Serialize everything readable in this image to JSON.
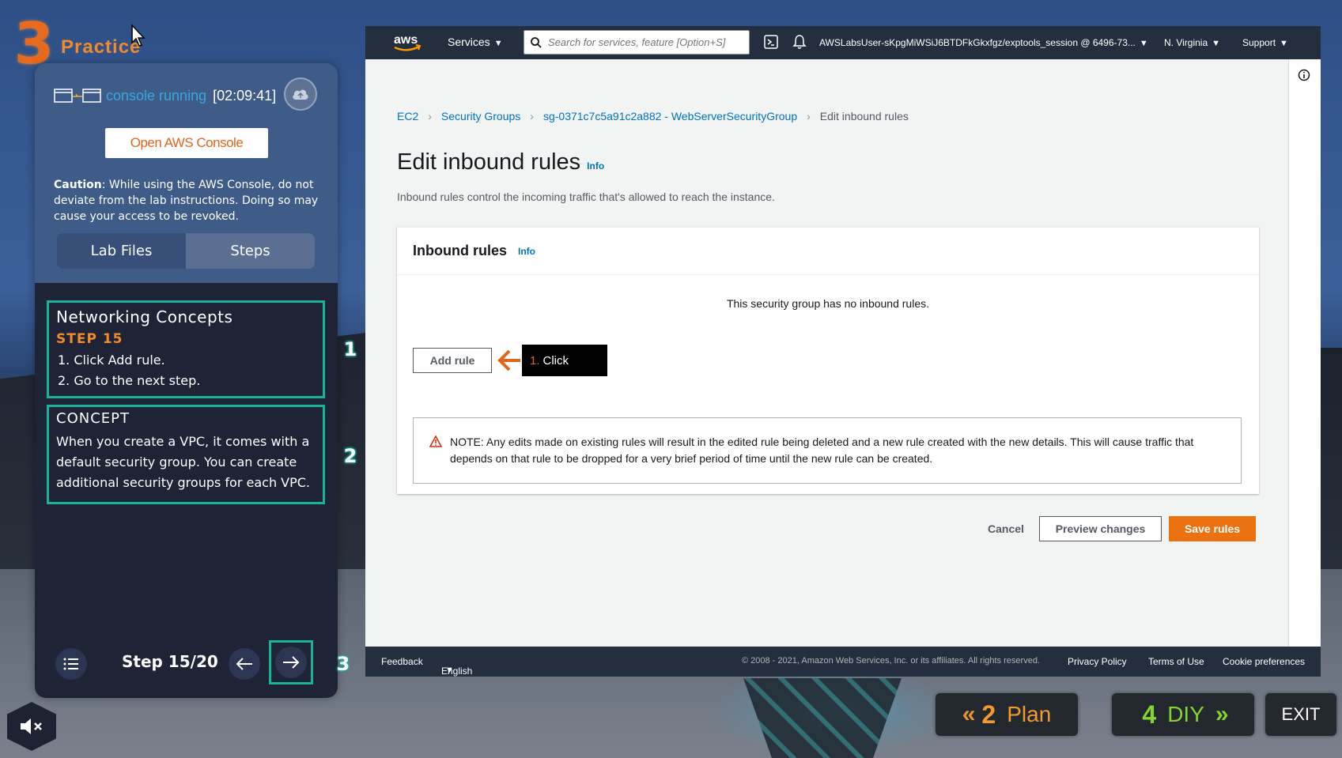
{
  "app": {
    "logo_number": "3",
    "logo_text": "Practice"
  },
  "lab_panel": {
    "status": "console running",
    "timer": "[02:09:41]",
    "open_console_label": "Open AWS Console",
    "caution_label": "Caution",
    "caution_text": ": While using the AWS Console, do not deviate from the lab instructions. Doing so may cause your access to be revoked.",
    "tabs": [
      {
        "label": "Lab Files"
      },
      {
        "label": "Steps"
      }
    ],
    "step": {
      "title": "Networking Concepts",
      "number_label": "STEP 15",
      "items": [
        "1.  Click Add rule.",
        "2.  Go to the next step."
      ]
    },
    "concept": {
      "title": "CONCEPT",
      "text": "When you create a VPC, it comes with a default security group. You can create additional security groups for each VPC."
    },
    "badges": [
      "1",
      "2",
      "3"
    ],
    "step_counter": "Step 15/20"
  },
  "aws_nav": {
    "logo_text": "aws",
    "services_label": "Services",
    "search_placeholder": "Search for services, feature [Option+S]",
    "account": "AWSLabsUser-sKpgMiWSiJ6BTDFkGkxfgz/exptools_session @ 6496-73...",
    "region": "N. Virginia",
    "support": "Support"
  },
  "breadcrumb": {
    "items": [
      "EC2",
      "Security Groups",
      "sg-0371c7c5a91c2a882 - WebServerSecurityGroup"
    ],
    "current": "Edit inbound rules"
  },
  "page": {
    "title": "Edit inbound rules",
    "info_label": "Info",
    "description": "Inbound rules control the incoming traffic that's allowed to reach the instance."
  },
  "inbound_panel": {
    "title": "Inbound rules",
    "info_label": "Info",
    "empty_message": "This security group has no inbound rules.",
    "add_rule_label": "Add rule",
    "callout_number": "1.",
    "callout_text": "Click",
    "note": "NOTE: Any edits made on existing rules will result in the edited rule being deleted and a new rule created with the new details. This will cause traffic that depends on that rule to be dropped for a very brief period of time until the new rule can be created."
  },
  "actions": {
    "cancel": "Cancel",
    "preview": "Preview changes",
    "save": "Save rules"
  },
  "footer": {
    "feedback": "Feedback",
    "language": "English (US)",
    "copyright": "© 2008 - 2021, Amazon Web Services, Inc. or its affiliates. All rights reserved.",
    "privacy": "Privacy Policy",
    "terms": "Terms of Use",
    "cookies": "Cookie preferences"
  },
  "game_nav": {
    "plan_number": "2",
    "plan_label": "Plan",
    "diy_number": "4",
    "diy_label": "DIY",
    "exit_label": "EXIT"
  },
  "colors": {
    "accent_orange": "#ec7211",
    "teal_highlight": "#19b39b",
    "aws_nav": "#232f3e",
    "link_blue": "#0073bb"
  }
}
